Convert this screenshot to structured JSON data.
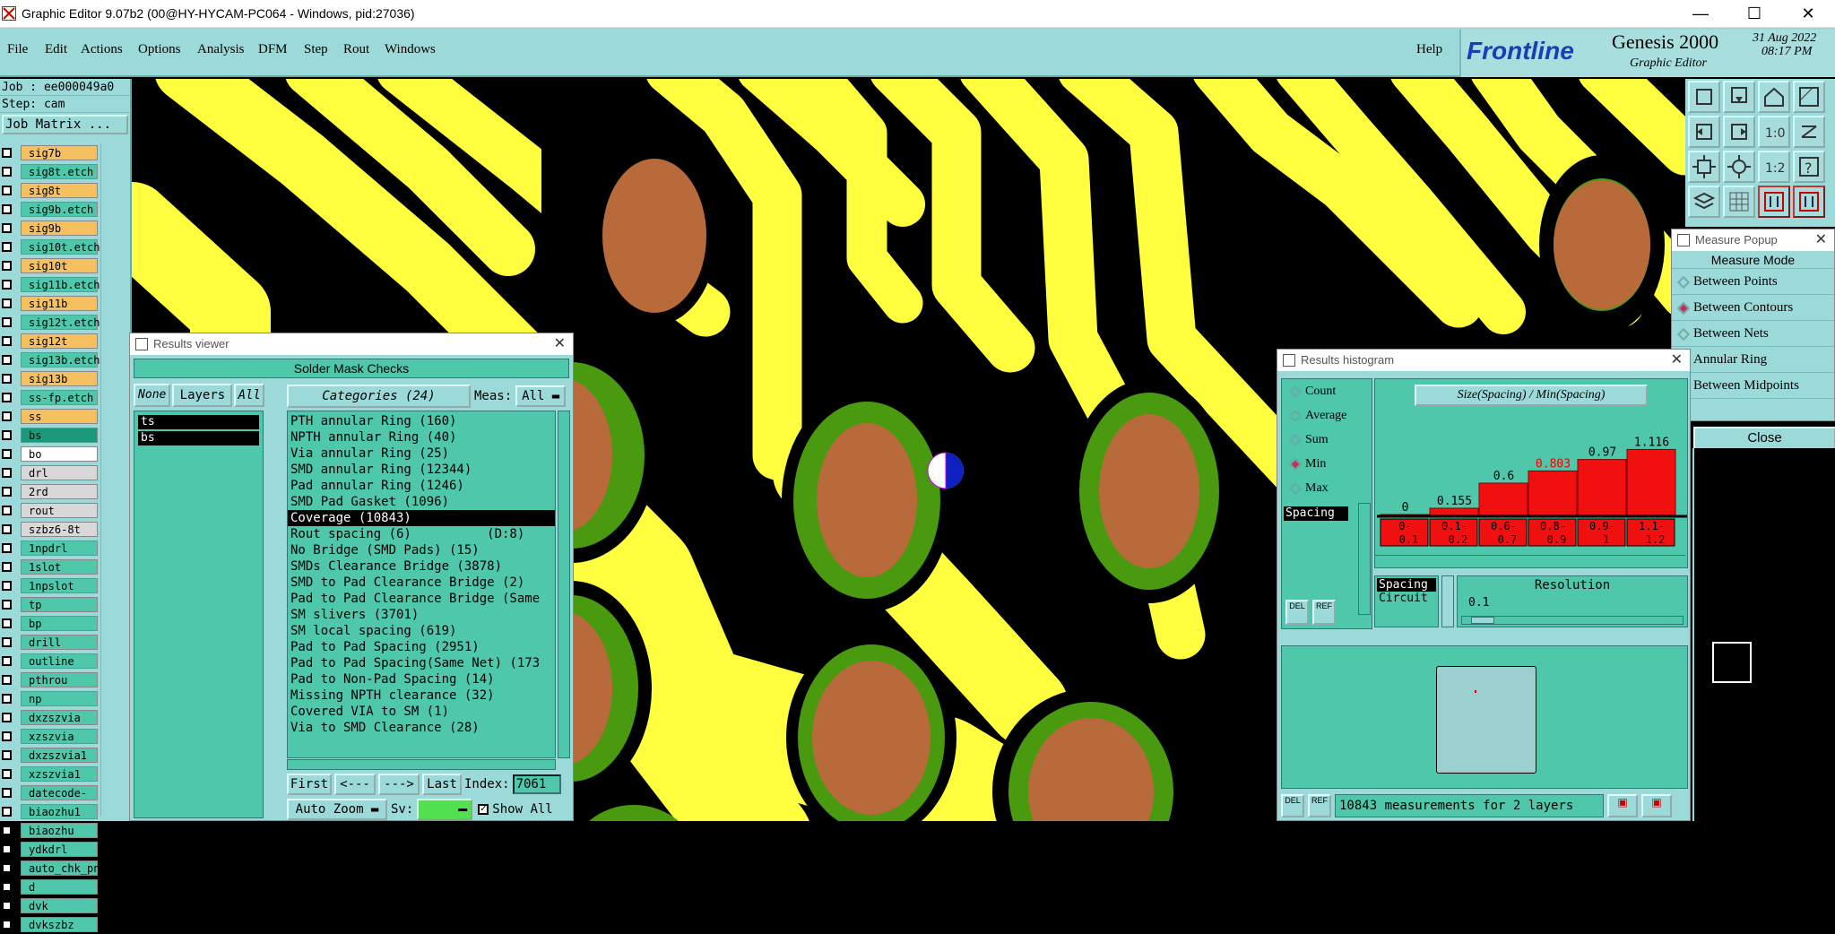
{
  "window": {
    "title": "Graphic Editor 9.07b2 (00@HY-HYCAM-PC064 - Windows, pid:27036)"
  },
  "menu": {
    "items": [
      "File",
      "Edit",
      "Actions",
      "Options",
      "Analysis",
      "DFM",
      "Step",
      "Rout",
      "Windows"
    ],
    "help": "Help"
  },
  "brand": {
    "logo": "Frontline",
    "product": "Genesis 2000",
    "subtitle": "Graphic Editor",
    "date": "31 Aug 2022",
    "time": "08:17 PM"
  },
  "left": {
    "job": "Job : ee000049a0",
    "step": "Step: cam",
    "job_matrix": "Job Matrix ...",
    "layers": [
      {
        "name": "sig7b",
        "color": "#f5c060"
      },
      {
        "name": "sig8t.etch",
        "color": "#4fc7aa"
      },
      {
        "name": "sig8t",
        "color": "#f5c060"
      },
      {
        "name": "sig9b.etch",
        "color": "#4fc7aa"
      },
      {
        "name": "sig9b",
        "color": "#f5c060"
      },
      {
        "name": "sig10t.etch",
        "color": "#4fc7aa"
      },
      {
        "name": "sig10t",
        "color": "#f5c060"
      },
      {
        "name": "sig11b.etch",
        "color": "#4fc7aa"
      },
      {
        "name": "sig11b",
        "color": "#f5c060"
      },
      {
        "name": "sig12t.etch",
        "color": "#4fc7aa"
      },
      {
        "name": "sig12t",
        "color": "#f5c060"
      },
      {
        "name": "sig13b.etch",
        "color": "#4fc7aa"
      },
      {
        "name": "sig13b",
        "color": "#f5c060"
      },
      {
        "name": "ss-fp.etch",
        "color": "#4fc7aa"
      },
      {
        "name": "ss",
        "color": "#f5c060"
      },
      {
        "name": "bs",
        "color": "#1a9a7a"
      },
      {
        "name": "bo",
        "color": "#ffffff"
      },
      {
        "name": "drl",
        "color": "#d8d8d8"
      },
      {
        "name": "2rd",
        "color": "#d8d8d8"
      },
      {
        "name": "rout",
        "color": "#d8d8d8"
      },
      {
        "name": "szbz6-8t",
        "color": "#d8d8d8"
      },
      {
        "name": "1npdrl",
        "color": "#4fc7aa"
      },
      {
        "name": "1slot",
        "color": "#4fc7aa"
      },
      {
        "name": "1npslot",
        "color": "#4fc7aa"
      },
      {
        "name": "tp",
        "color": "#4fc7aa"
      },
      {
        "name": "bp",
        "color": "#4fc7aa"
      },
      {
        "name": "drill",
        "color": "#4fc7aa"
      },
      {
        "name": "outline",
        "color": "#4fc7aa"
      },
      {
        "name": "pthrou",
        "color": "#4fc7aa"
      },
      {
        "name": "np",
        "color": "#4fc7aa"
      },
      {
        "name": "dxzszvia",
        "color": "#4fc7aa"
      },
      {
        "name": "xzszvia",
        "color": "#4fc7aa"
      },
      {
        "name": "dxzszvia1",
        "color": "#4fc7aa"
      },
      {
        "name": "xzszvia1",
        "color": "#4fc7aa"
      },
      {
        "name": "datecode-to",
        "color": "#4fc7aa"
      },
      {
        "name": "biaozhu1",
        "color": "#4fc7aa"
      },
      {
        "name": "biaozhu",
        "color": "#4fc7aa"
      },
      {
        "name": "ydkdrl",
        "color": "#4fc7aa"
      },
      {
        "name": "auto_chk_pn",
        "color": "#4fc7aa"
      },
      {
        "name": "d",
        "color": "#4fc7aa"
      },
      {
        "name": "dvk",
        "color": "#4fc7aa"
      },
      {
        "name": "dvkszbz",
        "color": "#4fc7aa"
      }
    ]
  },
  "measure": {
    "title": "Measure Popup",
    "mode_label": "Measure Mode",
    "options": [
      "Between Points",
      "Between Contours",
      "Between Nets",
      "Annular Ring",
      "Between Midpoints"
    ],
    "selected": "Between Contours",
    "close": "Close"
  },
  "results_viewer": {
    "title": "Results viewer",
    "header": "Solder Mask Checks",
    "none": "None",
    "layers": "Layers",
    "all": "All",
    "layer_list": [
      "ts",
      "bs"
    ],
    "categories_label": "Categories (24)",
    "meas_label": "Meas:",
    "meas_value": "All",
    "categories": [
      "PTH annular Ring (160)",
      "NPTH annular Ring (40)",
      "Via annular Ring (25)",
      "SMD annular Ring (12344)",
      "Pad annular Ring (1246)",
      "SMD Pad Gasket (1096)",
      "Coverage (10843)",
      "Rout spacing (6)          (D:8)",
      "No Bridge (SMD Pads) (15)",
      "SMDs Clearance Bridge (3878)",
      "SMD to Pad Clearance Bridge (2)",
      "Pad to Pad Clearance Bridge (Same",
      "SM slivers (3701)",
      "SM local spacing (619)",
      "Pad to Pad Spacing (2951)",
      "Pad to Pad Spacing(Same Net) (173",
      "Pad to Non-Pad Spacing (14)",
      "Missing NPTH clearance (32)",
      "Covered VIA to SM (1)",
      "Via to SMD Clearance (28)"
    ],
    "selected": "Coverage (10843)",
    "nav": {
      "first": "First",
      "prev": "<---",
      "next": "--->",
      "last": "Last",
      "index_label": "Index:",
      "index_value": "7061"
    },
    "auto_zoom": "Auto Zoom",
    "sv_label": "Sv:",
    "show_all": "Show All"
  },
  "histogram": {
    "title": "Results histogram",
    "options": [
      "Count",
      "Average",
      "Sum",
      "Min",
      "Max"
    ],
    "selected": "Min",
    "chart_title": "Size(Spacing) / Min(Spacing)",
    "list_item": "Spacing",
    "del": "DEL",
    "ref": "REF",
    "bins": [
      {
        "label_top": "0-",
        "label_bot": "0.1",
        "value": "0",
        "frac": 0.0
      },
      {
        "label_top": "0.1-",
        "label_bot": "0.2",
        "value": "0.155",
        "frac": 0.1
      },
      {
        "label_top": "0.6-",
        "label_bot": "0.7",
        "value": "0.6",
        "frac": 0.45
      },
      {
        "label_top": "0.8-",
        "label_bot": "0.9",
        "value": "0.803",
        "frac": 0.62
      },
      {
        "label_top": "0.9-",
        "label_bot": "1",
        "value": "0.97",
        "frac": 0.78
      },
      {
        "label_top": "1.1-",
        "label_bot": "1.2",
        "value": "1.116",
        "frac": 0.92
      }
    ],
    "highlight_value": "0.803",
    "attr_list": [
      "Spacing",
      "Circuit"
    ],
    "resolution_label": "Resolution",
    "resolution_value": "0.1",
    "status": "10843 measurements for 2 layers"
  }
}
